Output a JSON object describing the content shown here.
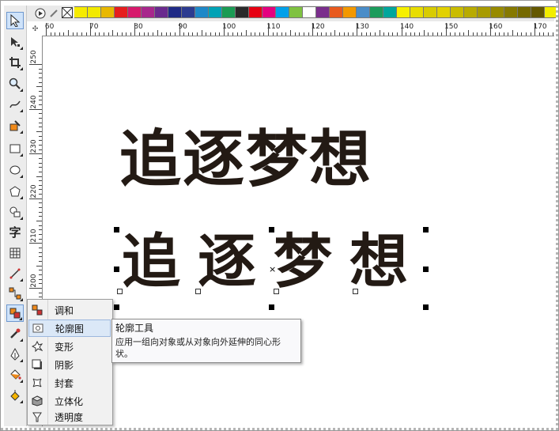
{
  "palette": {
    "colors": [
      "#f6eb00",
      "#f2e900",
      "#e8b800",
      "#e61e1e",
      "#d7196c",
      "#a8278c",
      "#6a2a8e",
      "#1f2a86",
      "#2c3b90",
      "#1e88c8",
      "#00a2b5",
      "#1a9b54",
      "#2a2a2a",
      "#e60012",
      "#e4007f",
      "#00a0e9",
      "#7fc241",
      "#ffffff",
      "#7a2e8c",
      "#e85a1e",
      "#f39800",
      "#4a8dc8",
      "#1b9c5c",
      "#00a69c",
      "#f6f000",
      "#e8dd00",
      "#d8cc00",
      "#e2d100",
      "#c9bc00",
      "#b8ab00",
      "#a89b00",
      "#978a00",
      "#867900",
      "#756900",
      "#645800",
      "#f3ee00"
    ]
  },
  "hruler": {
    "labels": [
      "60",
      "70",
      "80",
      "90",
      "100",
      "110",
      "120",
      "130",
      "140",
      "150",
      "160",
      "170"
    ]
  },
  "vruler": {
    "labels": [
      "250",
      "240",
      "230",
      "220",
      "210",
      "200"
    ]
  },
  "canvas": {
    "text_bold": "追逐梦想",
    "text_brush": [
      "追",
      "逐",
      "梦",
      "想"
    ],
    "center_mark": "×"
  },
  "toolbox": {
    "text_tool": "字"
  },
  "flyout": {
    "items": [
      {
        "label": "调和"
      },
      {
        "label": "轮廓图"
      },
      {
        "label": "变形"
      },
      {
        "label": "阴影"
      },
      {
        "label": "封套"
      },
      {
        "label": "立体化"
      },
      {
        "label": "透明度"
      }
    ]
  },
  "tooltip": {
    "title": "轮廓工具",
    "description": "应用一组向对象或从对象向外延伸的同心形状。"
  }
}
